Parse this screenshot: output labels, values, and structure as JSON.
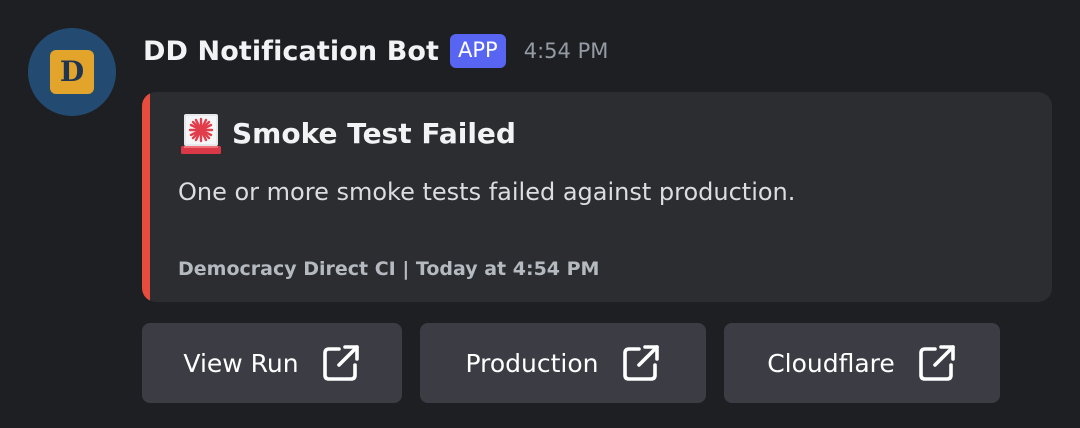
{
  "bot": {
    "avatar_letter": "D",
    "name": "DD Notification Bot",
    "badge": "APP",
    "time": "4:54 PM"
  },
  "embed": {
    "accent_color": "#e74c3c",
    "title_icon": "rotating-light-icon",
    "title": "Smoke Test Failed",
    "description": "One or more smoke tests failed against production.",
    "footer": "Democracy Direct CI | Today at 4:54 PM"
  },
  "buttons": [
    {
      "label": "View Run",
      "icon": "external-link-icon"
    },
    {
      "label": "Production",
      "icon": "external-link-icon"
    },
    {
      "label": "Cloudflare",
      "icon": "external-link-icon"
    }
  ],
  "colors": {
    "background": "#1e1f22",
    "embed_bg": "#2b2d31",
    "button_bg": "#3c3d44",
    "badge_bg": "#5865f2",
    "avatar_bg": "#234b72",
    "avatar_tile": "#e2a42b"
  }
}
